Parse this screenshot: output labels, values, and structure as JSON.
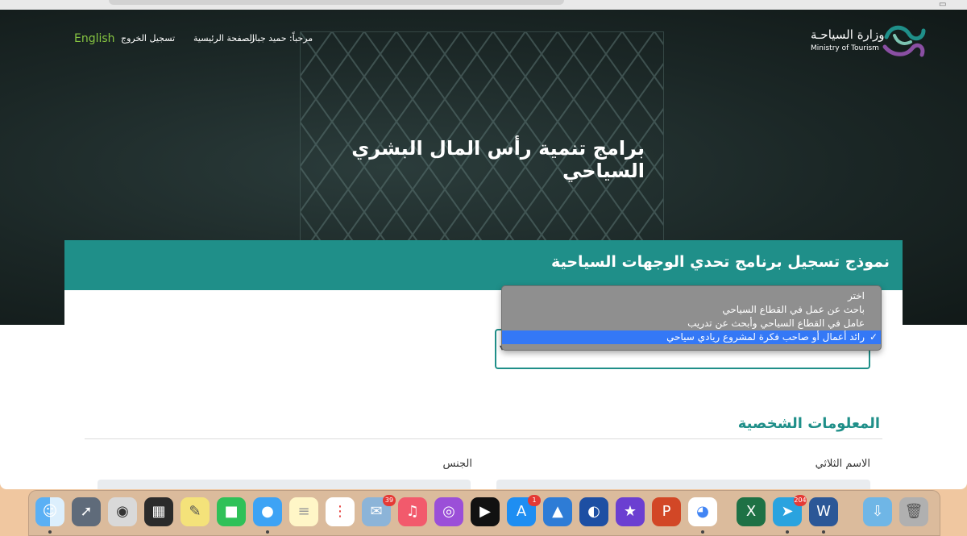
{
  "nav": {
    "language": "English",
    "logout": "تسجيل الخروج",
    "home": "الصفحة الرئيسية",
    "welcome": "مرحباً: حميد جبار"
  },
  "logo": {
    "arabic": "وزارة السياحـة",
    "english": "Ministry of Tourism"
  },
  "hero": {
    "title": "برامج تنمية رأس المال البشري السياحي"
  },
  "form": {
    "title": "نموذج تسجيل برنامج تحدي الوجهات السياحية",
    "dropdown": {
      "options": [
        "اختر",
        "باحث عن عمل في القطاع السياحي",
        "عامل في القطاع السياحي وأبحث عن تدريب",
        "رائد أعمال أو صاحب فكرة لمشروع ريادي سياحي"
      ],
      "selected": "رائد أعمال أو صاحب فكرة لمشروع ريادي سياحي",
      "check": "✓"
    },
    "section_title": "المعلومات الشخصية",
    "full_name_label": "الاسم الثلاثي",
    "gender_label": "الجنس"
  },
  "dock": {
    "badges": {
      "mail": "39",
      "appstore": "1",
      "telegram": "204"
    }
  },
  "colors": {
    "teal": "#1f8f89",
    "language_green": "#86c441",
    "selected_blue": "#3478f6"
  }
}
